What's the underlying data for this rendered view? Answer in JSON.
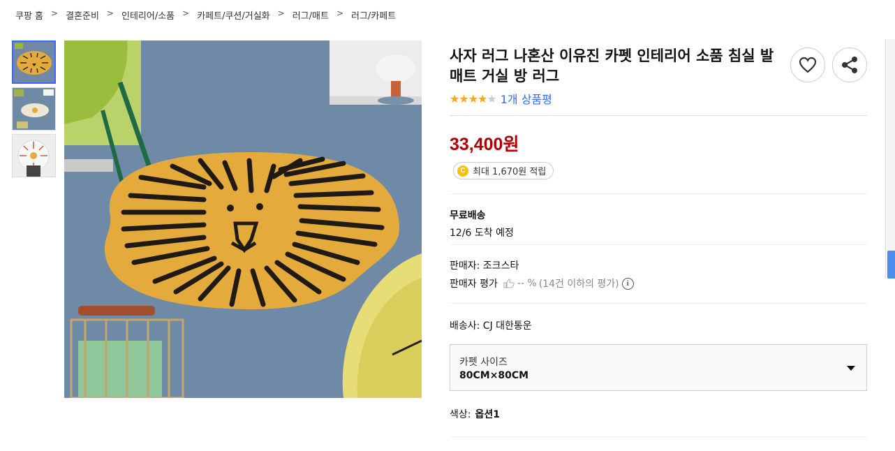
{
  "breadcrumb": [
    "쿠팡 홈",
    "결혼준비",
    "인테리어/소품",
    "카페트/쿠션/거실화",
    "러그/매트",
    "러그/카페트"
  ],
  "breadcrumb_separator": ">",
  "product": {
    "title": "사자 러그 나혼산 이유진 카펫 인테리어 소품 침실 발매트 거실 방 러그",
    "rating_stars": 4,
    "rating_max": 5,
    "review_text": "1개 상품평",
    "price": "33,400원",
    "cash_badge_icon": "C",
    "cash_text": "최대 1,670원 적립",
    "shipping_title": "무료배송",
    "shipping_date": "12/6 도착 예정",
    "seller_text": "판매자: 조크스타",
    "seller_rating_label": "판매자 평가",
    "seller_rating_value": "-- %",
    "seller_rating_note": "(14건 이하의 평가)",
    "info_icon": "i",
    "carrier_text": "배송사: CJ 대한통운",
    "option": {
      "label": "카펫 사이즈",
      "value": "80CM×80CM"
    },
    "color_label": "색상:",
    "color_value": "옵션1"
  },
  "colors": {
    "price": "#ae0000",
    "link": "#346aff",
    "star": "#f5a623",
    "rug": "#e4ab3c",
    "carpet": "#6f8aa6"
  }
}
